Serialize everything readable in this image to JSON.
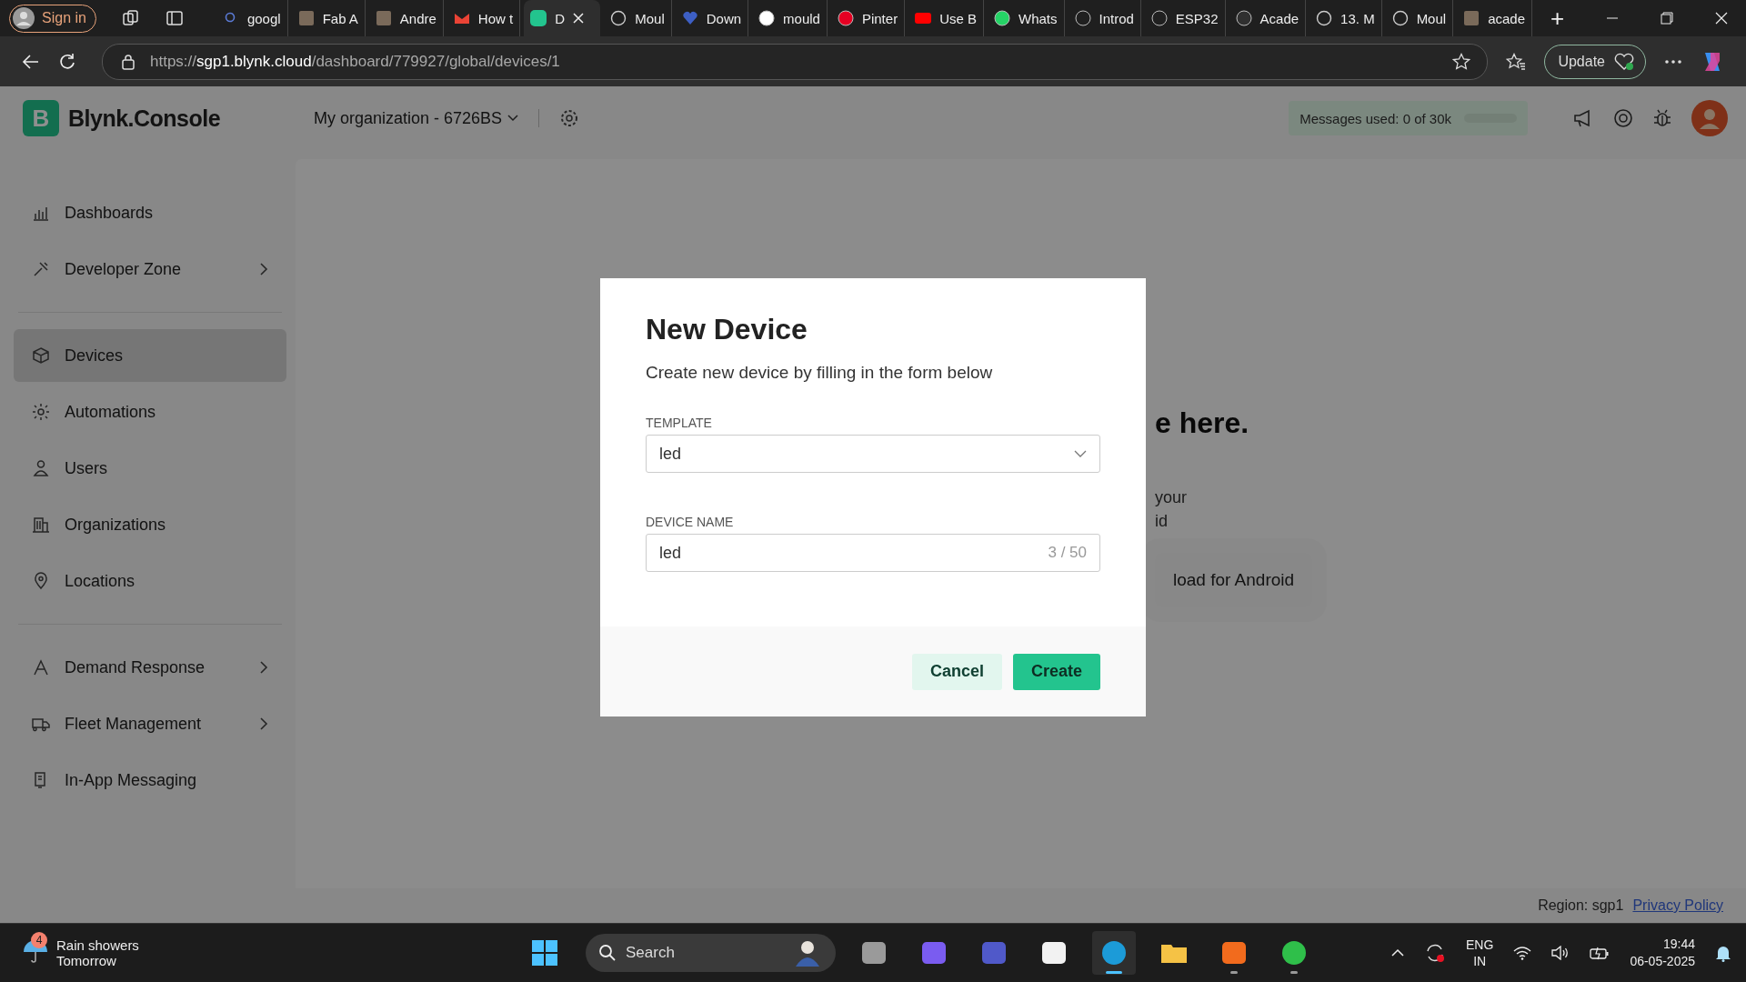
{
  "browser": {
    "profile_button": "Sign in",
    "tabs": [
      {
        "label": "googl",
        "kind": "search",
        "selected": false
      },
      {
        "label": "Fab A",
        "kind": "photo",
        "selected": false
      },
      {
        "label": "Andre",
        "kind": "photo",
        "selected": false
      },
      {
        "label": "How t",
        "kind": "gmail",
        "selected": false
      },
      {
        "label": "D",
        "kind": "blynk",
        "selected": true
      },
      {
        "label": "Moul",
        "kind": "globe",
        "selected": false
      },
      {
        "label": "Down",
        "kind": "heart",
        "selected": false
      },
      {
        "label": "mould",
        "kind": "google",
        "selected": false
      },
      {
        "label": "Pinter",
        "kind": "pinterest",
        "selected": false
      },
      {
        "label": "Use B",
        "kind": "youtube",
        "selected": false
      },
      {
        "label": "Whats",
        "kind": "whatsapp",
        "selected": false
      },
      {
        "label": "Introd",
        "kind": "openai",
        "selected": false
      },
      {
        "label": "ESP32",
        "kind": "openai",
        "selected": false
      },
      {
        "label": "Acade",
        "kind": "cloud",
        "selected": false
      },
      {
        "label": "13. M",
        "kind": "globe",
        "selected": false
      },
      {
        "label": "Moul",
        "kind": "globe",
        "selected": false
      },
      {
        "label": "acade",
        "kind": "photo",
        "selected": false
      }
    ],
    "new_tab": "+",
    "url": {
      "scheme": "https://",
      "host": "sgp1.blynk.cloud",
      "path": "/dashboard/779927/global/devices/1"
    },
    "update_button": "Update"
  },
  "app": {
    "logo": "B",
    "brand": "Blynk.Console",
    "organization": "My organization - 6726BS",
    "messages": {
      "label": "Messages used: 0 of 30k",
      "level": 0
    },
    "sidebar": [
      {
        "label": "Dashboards",
        "kind": "dashboards",
        "selected": false,
        "expandable": false,
        "divider_after": false
      },
      {
        "label": "Developer Zone",
        "kind": "developer",
        "selected": false,
        "expandable": true,
        "divider_after": true
      },
      {
        "label": "Devices",
        "kind": "devices",
        "selected": true,
        "expandable": false,
        "divider_after": false
      },
      {
        "label": "Automations",
        "kind": "automations",
        "selected": false,
        "expandable": false,
        "divider_after": false
      },
      {
        "label": "Users",
        "kind": "users",
        "selected": false,
        "expandable": false,
        "divider_after": false
      },
      {
        "label": "Organizations",
        "kind": "organizations",
        "selected": false,
        "expandable": false,
        "divider_after": false
      },
      {
        "label": "Locations",
        "kind": "locations",
        "selected": false,
        "expandable": false,
        "divider_after": true
      },
      {
        "label": "Demand Response",
        "kind": "demand",
        "selected": false,
        "expandable": true,
        "divider_after": false
      },
      {
        "label": "Fleet Management",
        "kind": "fleet",
        "selected": false,
        "expandable": true,
        "divider_after": false
      },
      {
        "label": "In-App Messaging",
        "kind": "messaging",
        "selected": false,
        "expandable": false,
        "divider_after": false
      }
    ],
    "background": {
      "heading": "e here.",
      "lines": [
        "your",
        "id"
      ],
      "button": "load for Android"
    },
    "footer": {
      "region": "Region: sgp1",
      "link": "Privacy Policy"
    }
  },
  "dialog": {
    "title": "New Device",
    "subtitle": "Create new device by filling in the form below",
    "template": {
      "label": "TEMPLATE",
      "value": "led"
    },
    "device_name": {
      "label": "DEVICE NAME",
      "value": "led",
      "counter": "3 / 50"
    },
    "buttons": [
      {
        "label": "Cancel",
        "kind": "secondary"
      },
      {
        "label": "Create",
        "kind": "primary"
      }
    ]
  },
  "taskbar": {
    "weather": {
      "badge": "4",
      "title": "Rain showers",
      "subtitle": "Tomorrow"
    },
    "search": {
      "placeholder": "Search"
    },
    "apps": [
      {
        "kind": "files",
        "selected": false,
        "running": false
      },
      {
        "kind": "copilot",
        "selected": false,
        "running": false
      },
      {
        "kind": "teams",
        "selected": false,
        "running": false
      },
      {
        "kind": "store",
        "selected": false,
        "running": false
      },
      {
        "kind": "edge",
        "selected": true,
        "running": true
      },
      {
        "kind": "folder",
        "selected": false,
        "running": false
      },
      {
        "kind": "fusion",
        "selected": false,
        "running": true
      },
      {
        "kind": "greenapp",
        "selected": false,
        "running": true
      }
    ],
    "language": [
      "ENG",
      "IN"
    ],
    "time": "19:44",
    "date": "06-05-2025"
  }
}
